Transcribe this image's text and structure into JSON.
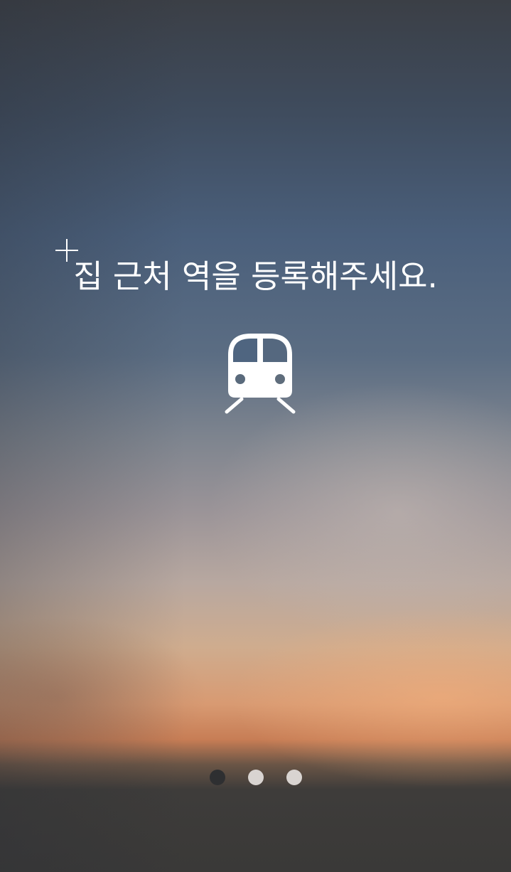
{
  "onboarding": {
    "message": "집 근처 역을 등록해주세요.",
    "icon": "train-icon"
  },
  "pager": {
    "count": 3,
    "active_index": 0
  },
  "colors": {
    "text": "#ffffff",
    "dot_active": "#2e2f31",
    "dot_inactive": "#d9d4d1"
  }
}
